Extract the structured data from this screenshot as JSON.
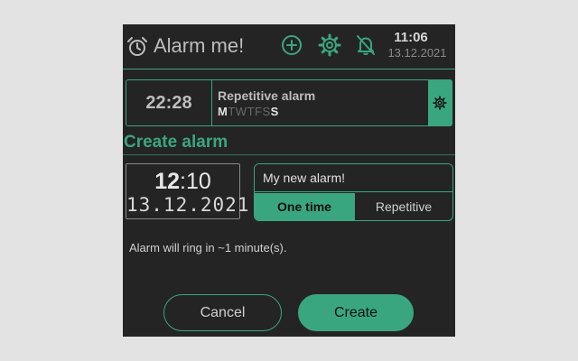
{
  "header": {
    "title": "Alarm me!",
    "icons": [
      "alarm-clock-icon",
      "add-circle-icon",
      "gear-icon",
      "bell-off-icon"
    ],
    "time": "11:06",
    "date": "13.12.2021"
  },
  "existing_alarm": {
    "time": "22:28",
    "name": "Repetitive alarm",
    "days": [
      {
        "label": "M",
        "active": true
      },
      {
        "label": "T",
        "active": false
      },
      {
        "label": "W",
        "active": false
      },
      {
        "label": "T",
        "active": false
      },
      {
        "label": "F",
        "active": false
      },
      {
        "label": "S",
        "active": false
      },
      {
        "label": "S",
        "active": true
      }
    ]
  },
  "create": {
    "title": "Create alarm",
    "hour": "12",
    "sep": ":",
    "minute": "10",
    "date": "13.12.2021",
    "name_value": "My new alarm!",
    "mode_one_time": "One time",
    "mode_repetitive": "Repetitive",
    "info": "Alarm will ring in ~1 minute(s).",
    "cancel_label": "Cancel",
    "create_label": "Create"
  },
  "colors": {
    "accent": "#3aa680",
    "background": "#242424",
    "page": "#e3e3e3"
  }
}
